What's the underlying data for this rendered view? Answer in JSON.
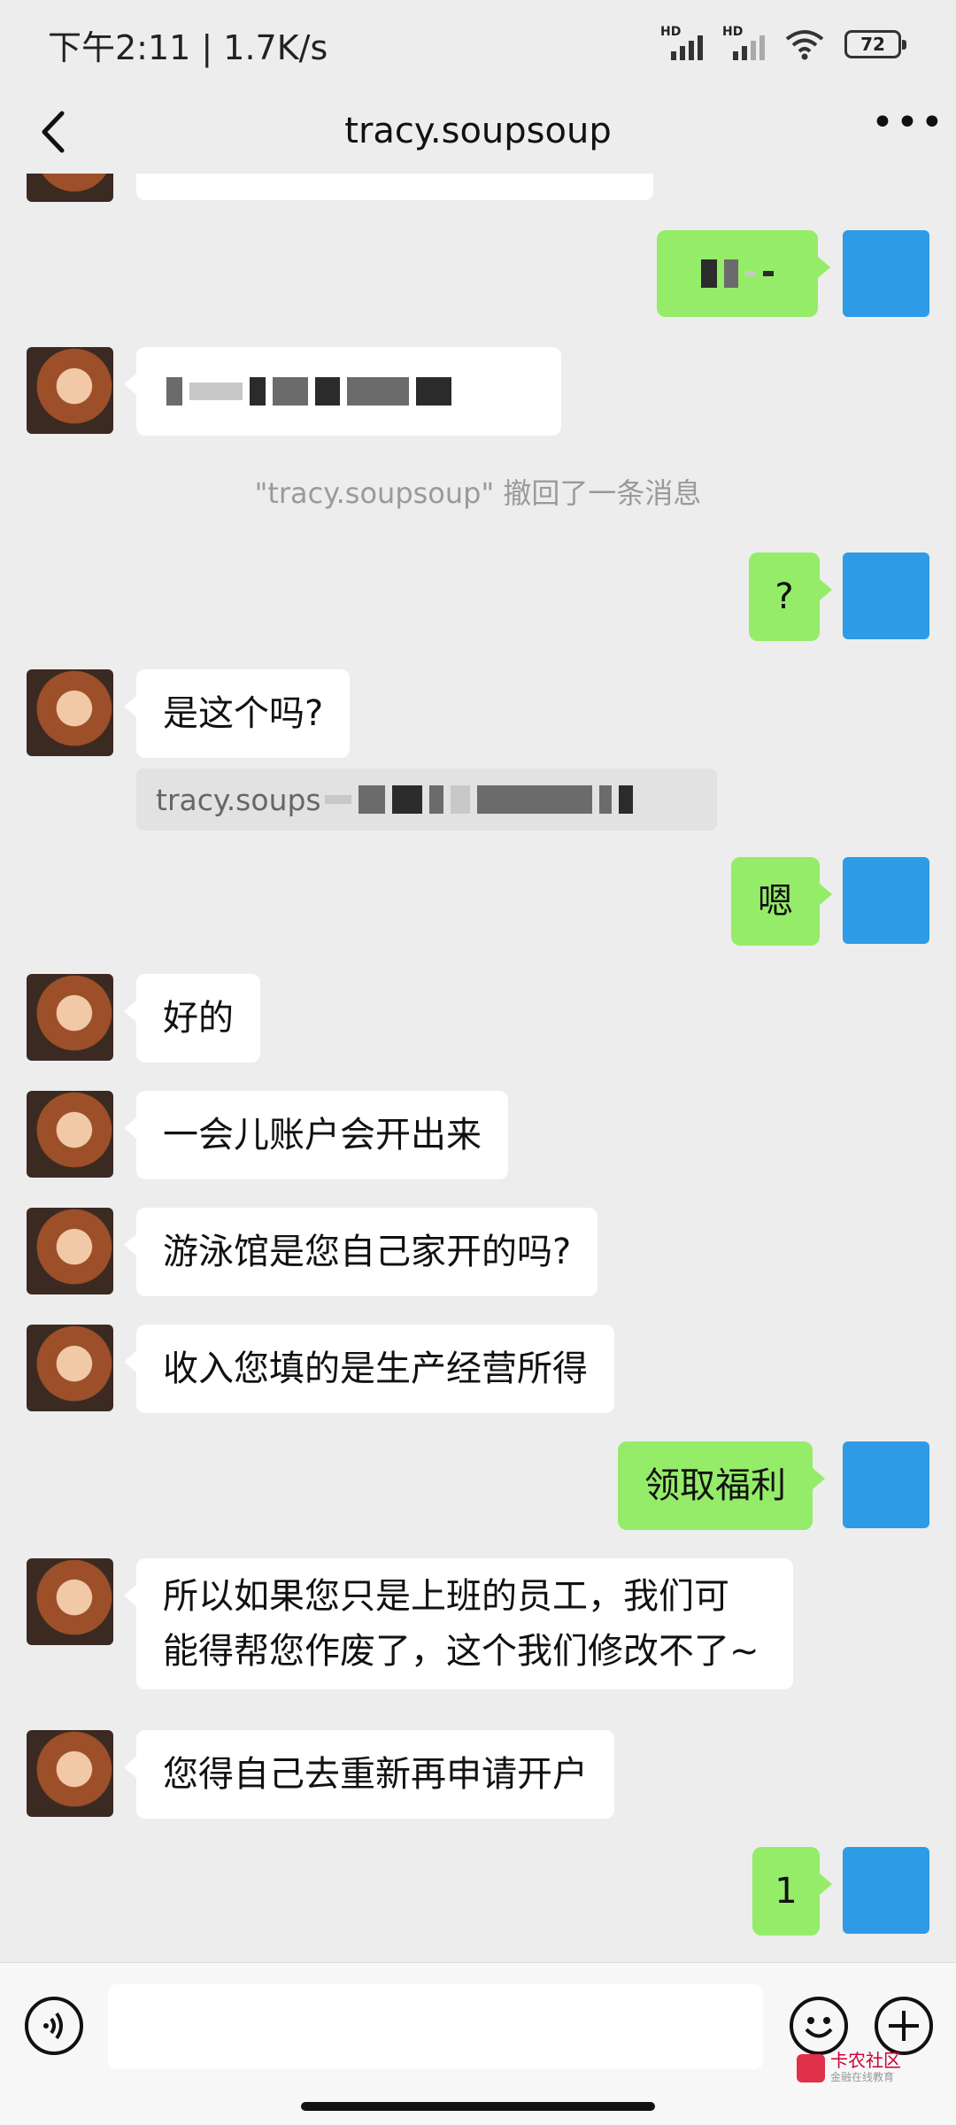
{
  "status_bar": {
    "time_speed": "下午2:11 | 1.7K/s",
    "hd_label_1": "HD",
    "hd_label_2": "HD",
    "battery": "72"
  },
  "header": {
    "title": "tracy.soupsoup",
    "back_icon": "chevron-left-icon",
    "more_icon": "more-dots-icon"
  },
  "messages": {
    "recall_notice": "\"tracy.soupsoup\" 撤回了一条消息",
    "m_question": "?",
    "m_is_this": "是这个吗?",
    "quote_text": "tracy.soups",
    "m_en": "嗯",
    "m_ok": "好的",
    "m_account": "一会儿账户会开出来",
    "m_pool": "游泳馆是您自己家开的吗?",
    "m_income": "收入您填的是生产经营所得",
    "m_welfare": "领取福利",
    "m_employee_1": "所以如果您只是上班的员工，我们可",
    "m_employee_2": "能得帮您作废了，这个我们修改不了~",
    "m_reapply": "您得自己去重新再申请开户",
    "m_one": "1"
  },
  "input_bar": {
    "voice_icon": "voice-icon",
    "emoji_icon": "emoji-icon",
    "plus_icon": "plus-icon",
    "watermark_main": "卡农社区",
    "watermark_sub": "金融在线教育"
  },
  "colors": {
    "background": "#ededed",
    "outgoing_bubble": "#95ec69",
    "incoming_bubble": "#ffffff",
    "doraemon_blue": "#2e9be6"
  }
}
